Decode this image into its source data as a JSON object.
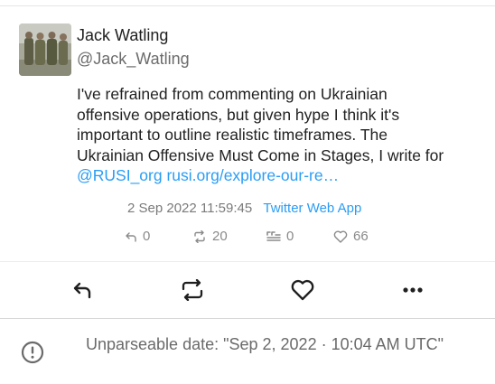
{
  "tweet": {
    "author_name": "Jack Watling",
    "author_handle": "@Jack_Watling",
    "text_lines": [
      "I've refrained from commenting on Ukrainian",
      "offensive operations, but given hype I think it's",
      "important to outline realistic timeframes. The",
      "Ukrainian Offensive Must Come in Stages, I write for"
    ],
    "mention": "@RUSI_org",
    "link": "rusi.org/explore-our-re…",
    "date": "2 Sep 2022 11:59:45",
    "client": "Twitter Web App",
    "stats": {
      "replies": "0",
      "retweets": "20",
      "quotes": "0",
      "likes": "66"
    }
  },
  "actions": {
    "reply_icon": "reply-icon",
    "retweet_icon": "retweet-icon",
    "like_icon": "heart-icon",
    "more_icon": "more-icon"
  },
  "notice": {
    "icon": "error-icon",
    "text": "Unparseable date: \"Sep 2, 2022 · 10:04 AM UTC\""
  },
  "colors": {
    "link": "#2a9df4",
    "muted": "#8a8a8a",
    "text": "#222222"
  }
}
